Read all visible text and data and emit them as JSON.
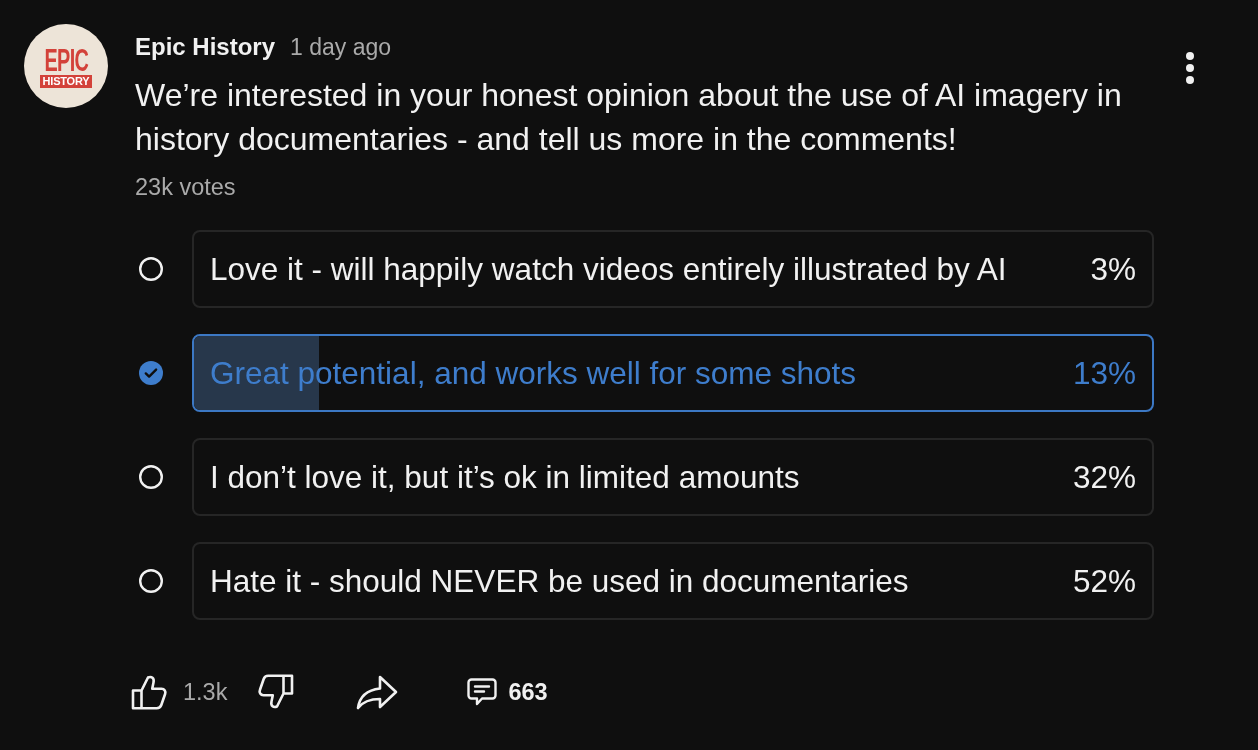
{
  "post": {
    "avatar": {
      "line_1": "EPIC",
      "line_2": "HISTORY"
    },
    "author": "Epic History",
    "time": "1 day ago",
    "text": "We’re interested in your honest opinion about the use of AI imagery in history documentaries - and tell us more in the comments!",
    "votes": "23k votes"
  },
  "poll": {
    "options": [
      {
        "label": "Love it - will happily watch videos entirely illustrated by AI",
        "percent": "3%",
        "selected": false
      },
      {
        "label": "Great potential, and works well for some shots",
        "percent": "13%",
        "selected": true,
        "level": 0.13
      },
      {
        "label": "I don’t love it, but it’s ok in limited amounts",
        "percent": "32%",
        "selected": false
      },
      {
        "label": "Hate it - should NEVER be used in documentaries",
        "percent": "52%",
        "selected": false
      }
    ]
  },
  "actions": {
    "likes": "1.3k",
    "comments": "663"
  }
}
